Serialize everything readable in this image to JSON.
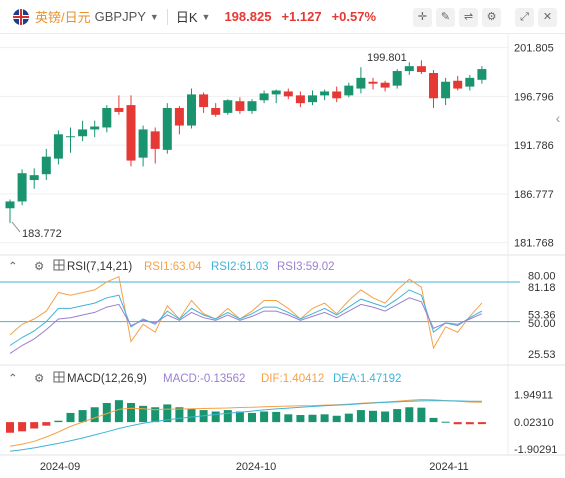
{
  "header": {
    "symbol_name": "英镑/日元",
    "symbol_code": "GBPJPY",
    "period": "日K",
    "last_price": "198.825",
    "change": "+1.127",
    "change_pct": "+0.57%",
    "tools": [
      "crosshair-icon",
      "drawing-icon",
      "compare-icon",
      "settings-icon",
      "fullscreen-icon",
      "close-icon"
    ]
  },
  "colors": {
    "up": "#1a936f",
    "down": "#e53935",
    "rsi1": "#f5a148",
    "rsi2": "#3fb4d8",
    "rsi3": "#9b7fd1",
    "dif": "#f5a148",
    "dea": "#3fb4d8"
  },
  "chart_data": [
    {
      "type": "candlestick",
      "title": "GBPJPY 日K",
      "y_ticks": [
        "201.805",
        "196.796",
        "191.786",
        "186.777",
        "181.768"
      ],
      "ylim": [
        180.6,
        203.0
      ],
      "x_labels": [
        "2024-09",
        "2024-10",
        "2024-11"
      ],
      "annotations": {
        "high": "199.801",
        "low": "183.772"
      },
      "candles": [
        {
          "o": 185.3,
          "h": 186.2,
          "l": 183.8,
          "c": 186.0
        },
        {
          "o": 186.0,
          "h": 189.3,
          "l": 185.6,
          "c": 188.9
        },
        {
          "o": 188.2,
          "h": 189.4,
          "l": 187.3,
          "c": 188.7
        },
        {
          "o": 188.8,
          "h": 191.4,
          "l": 188.2,
          "c": 190.6
        },
        {
          "o": 190.4,
          "h": 193.3,
          "l": 189.8,
          "c": 192.9
        },
        {
          "o": 192.6,
          "h": 193.6,
          "l": 191.0,
          "c": 192.7
        },
        {
          "o": 192.7,
          "h": 194.3,
          "l": 192.2,
          "c": 193.4
        },
        {
          "o": 193.4,
          "h": 194.3,
          "l": 192.6,
          "c": 193.7
        },
        {
          "o": 193.6,
          "h": 195.9,
          "l": 193.1,
          "c": 195.6
        },
        {
          "o": 195.6,
          "h": 196.9,
          "l": 194.9,
          "c": 195.2
        },
        {
          "o": 195.9,
          "h": 196.9,
          "l": 189.6,
          "c": 190.2
        },
        {
          "o": 190.5,
          "h": 193.8,
          "l": 189.6,
          "c": 193.4
        },
        {
          "o": 193.2,
          "h": 193.6,
          "l": 189.9,
          "c": 191.4
        },
        {
          "o": 191.3,
          "h": 196.1,
          "l": 190.9,
          "c": 195.6
        },
        {
          "o": 195.6,
          "h": 195.8,
          "l": 192.9,
          "c": 193.8
        },
        {
          "o": 193.8,
          "h": 197.6,
          "l": 193.5,
          "c": 197.0
        },
        {
          "o": 197.0,
          "h": 197.2,
          "l": 195.1,
          "c": 195.7
        },
        {
          "o": 195.6,
          "h": 196.1,
          "l": 194.7,
          "c": 194.9
        },
        {
          "o": 195.1,
          "h": 196.5,
          "l": 194.9,
          "c": 196.4
        },
        {
          "o": 196.3,
          "h": 196.7,
          "l": 195.0,
          "c": 195.3
        },
        {
          "o": 195.3,
          "h": 196.5,
          "l": 195.0,
          "c": 196.3
        },
        {
          "o": 196.4,
          "h": 197.4,
          "l": 196.1,
          "c": 197.1
        },
        {
          "o": 197.0,
          "h": 197.5,
          "l": 196.1,
          "c": 197.4
        },
        {
          "o": 197.3,
          "h": 197.6,
          "l": 196.5,
          "c": 196.8
        },
        {
          "o": 196.9,
          "h": 197.3,
          "l": 195.7,
          "c": 196.1
        },
        {
          "o": 196.2,
          "h": 197.4,
          "l": 195.9,
          "c": 196.9
        },
        {
          "o": 196.9,
          "h": 197.5,
          "l": 196.4,
          "c": 197.3
        },
        {
          "o": 197.3,
          "h": 197.8,
          "l": 196.2,
          "c": 196.6
        },
        {
          "o": 196.9,
          "h": 198.2,
          "l": 196.7,
          "c": 197.9
        },
        {
          "o": 197.6,
          "h": 199.8,
          "l": 197.1,
          "c": 198.7
        },
        {
          "o": 198.3,
          "h": 198.7,
          "l": 197.5,
          "c": 198.1
        },
        {
          "o": 198.2,
          "h": 198.4,
          "l": 197.3,
          "c": 197.7
        },
        {
          "o": 197.9,
          "h": 199.6,
          "l": 197.6,
          "c": 199.4
        },
        {
          "o": 199.4,
          "h": 200.3,
          "l": 199.0,
          "c": 199.9
        },
        {
          "o": 199.9,
          "h": 200.5,
          "l": 199.1,
          "c": 199.3
        },
        {
          "o": 199.2,
          "h": 199.5,
          "l": 195.6,
          "c": 196.6
        },
        {
          "o": 196.6,
          "h": 198.7,
          "l": 195.9,
          "c": 198.3
        },
        {
          "o": 198.4,
          "h": 198.9,
          "l": 197.4,
          "c": 197.6
        },
        {
          "o": 197.8,
          "h": 199.0,
          "l": 197.4,
          "c": 198.7
        },
        {
          "o": 198.5,
          "h": 199.9,
          "l": 198.1,
          "c": 199.6
        }
      ]
    },
    {
      "type": "line",
      "title": "RSI(7,14,21)",
      "series_labels": [
        "RSI1:63.04",
        "RSI2:61.03",
        "RSI3:59.02"
      ],
      "y_ticks": [
        "80.00",
        "81.18",
        "53.36",
        "50.00",
        "25.53"
      ],
      "ylim": [
        18,
        86
      ],
      "reference_lines": [
        80,
        50
      ],
      "series": [
        {
          "name": "RSI1",
          "values": [
            40,
            48,
            52,
            58,
            72,
            70,
            72,
            74,
            80,
            84,
            35,
            48,
            42,
            62,
            52,
            66,
            56,
            52,
            60,
            52,
            58,
            66,
            66,
            60,
            52,
            60,
            64,
            56,
            66,
            74,
            68,
            64,
            74,
            82,
            76,
            30,
            46,
            42,
            54,
            64
          ]
        },
        {
          "name": "RSI2",
          "values": [
            32,
            38,
            43,
            50,
            60,
            60,
            62,
            64,
            68,
            70,
            46,
            52,
            48,
            58,
            52,
            60,
            55,
            52,
            57,
            52,
            56,
            61,
            61,
            57,
            52,
            56,
            60,
            55,
            61,
            67,
            64,
            61,
            67,
            74,
            70,
            42,
            49,
            47,
            53,
            58
          ]
        },
        {
          "name": "RSI3",
          "values": [
            26,
            32,
            37,
            44,
            52,
            53,
            55,
            57,
            61,
            63,
            47,
            51,
            49,
            55,
            51,
            57,
            53,
            51,
            55,
            51,
            54,
            58,
            58,
            55,
            51,
            54,
            57,
            53,
            58,
            63,
            61,
            58,
            63,
            68,
            65,
            45,
            49,
            48,
            52,
            56
          ]
        }
      ]
    },
    {
      "type": "bar",
      "title": "MACD(12,26,9)",
      "series_labels": [
        "MACD:-0.13562",
        "DIF:1.40412",
        "DEA:1.47192"
      ],
      "y_ticks": [
        "1.94911",
        "0.02310",
        "-1.90291"
      ],
      "ylim": [
        -2.25,
        2.55
      ],
      "series": [
        {
          "name": "MACD",
          "values": [
            -0.75,
            -0.65,
            -0.45,
            -0.25,
            0.1,
            0.65,
            0.85,
            1.05,
            1.35,
            1.55,
            1.35,
            1.15,
            1.05,
            1.25,
            1.05,
            0.95,
            0.85,
            0.75,
            0.85,
            0.75,
            0.65,
            0.75,
            0.72,
            0.55,
            0.5,
            0.52,
            0.55,
            0.45,
            0.6,
            0.85,
            0.8,
            0.75,
            0.92,
            1.05,
            1.02,
            0.3,
            0.03,
            -0.15,
            -0.15,
            -0.14
          ]
        },
        {
          "name": "DIF",
          "values": [
            -1.7,
            -1.55,
            -1.35,
            -1.05,
            -0.7,
            -0.3,
            0.0,
            0.3,
            0.6,
            0.9,
            0.98,
            0.95,
            0.88,
            0.92,
            0.92,
            0.95,
            0.96,
            0.98,
            1.0,
            1.03,
            1.05,
            1.08,
            1.11,
            1.13,
            1.15,
            1.17,
            1.2,
            1.23,
            1.27,
            1.33,
            1.38,
            1.42,
            1.48,
            1.55,
            1.6,
            1.58,
            1.52,
            1.47,
            1.42,
            1.4
          ]
        },
        {
          "name": "DEA",
          "values": [
            -2.05,
            -1.95,
            -1.82,
            -1.66,
            -1.5,
            -1.32,
            -1.12,
            -0.9,
            -0.68,
            -0.45,
            -0.25,
            -0.08,
            0.05,
            0.16,
            0.26,
            0.36,
            0.45,
            0.54,
            0.62,
            0.7,
            0.78,
            0.86,
            0.93,
            0.99,
            1.05,
            1.1,
            1.15,
            1.2,
            1.24,
            1.3,
            1.35,
            1.39,
            1.43,
            1.47,
            1.5,
            1.52,
            1.51,
            1.5,
            1.48,
            1.47
          ]
        }
      ]
    }
  ]
}
